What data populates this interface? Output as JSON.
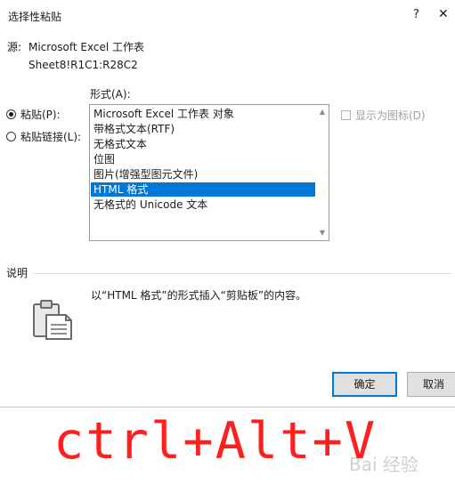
{
  "window": {
    "title": "选择性粘贴",
    "help": "?",
    "close": "✕"
  },
  "source": {
    "label": "源:",
    "value": "Microsoft Excel 工作表",
    "range": "Sheet8!R1C1:R28C2"
  },
  "paste_options": [
    {
      "label": "粘贴(P):",
      "checked": true
    },
    {
      "label": "粘贴链接(L):",
      "checked": false
    }
  ],
  "format": {
    "label": "形式(A):",
    "items": [
      "Microsoft Excel 工作表 对象",
      "带格式文本(RTF)",
      "无格式文本",
      "位图",
      "图片(增强型图元文件)",
      "HTML 格式",
      "无格式的 Unicode 文本"
    ],
    "selected_index": 5
  },
  "display_as_icon": {
    "label": "显示为图标(D)",
    "checked": false,
    "enabled": false
  },
  "description": {
    "label": "说明",
    "text": "以“HTML 格式”的形式插入“剪贴板”的内容。",
    "icon": "clipboard-icon"
  },
  "buttons": {
    "ok": "确定",
    "cancel": "取消"
  },
  "overlay": {
    "shortcut": "ctrl+Alt+V",
    "watermark": "Bai 经验"
  },
  "colors": {
    "selection": "#0078d7",
    "shortcut": "#ff1f1f"
  }
}
